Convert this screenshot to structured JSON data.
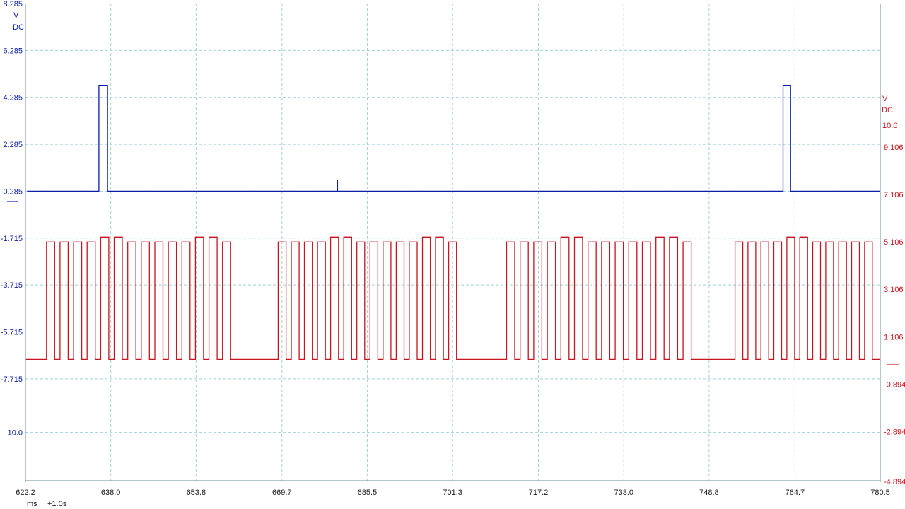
{
  "colors": {
    "channel_a": "#0b1fa8",
    "channel_b": "#c8141e",
    "grid": "#9fd2d8",
    "axis_text": "#1a1a1a",
    "background": "#ffffff"
  },
  "time_axis": {
    "unit_label": "ms",
    "offset_label": "+1.0s",
    "ticks": [
      "622.2",
      "638.0",
      "653.8",
      "669.7",
      "685.5",
      "701.3",
      "717.2",
      "733.0",
      "748.8",
      "764.7",
      "780.5"
    ]
  },
  "chart_data": {
    "type": "line",
    "grid": true,
    "x_range": [
      622.2,
      780.5
    ],
    "x_ticks": [
      622.2,
      638.0,
      653.8,
      669.7,
      685.5,
      701.3,
      717.2,
      733.0,
      748.8,
      764.7,
      780.5
    ],
    "y_left": {
      "unit": "V",
      "coupling": "DC",
      "range": [
        -12.0,
        8.285
      ],
      "tick_labels": [
        "8.285",
        "6.285",
        "4.285",
        "2.285",
        "0.285",
        "-1.715",
        "-3.715",
        "-5.715",
        "-7.715",
        "-10.0"
      ],
      "tick_values": [
        8.285,
        6.285,
        4.285,
        2.285,
        0.285,
        -1.715,
        -3.715,
        -5.715,
        -7.715,
        -10.0
      ]
    },
    "y_right": {
      "unit": "V",
      "coupling": "DC",
      "range": [
        -4.894,
        12.0
      ],
      "tick_labels": [
        "10.0",
        "9.106",
        "7.106",
        "5.106",
        "3.106",
        "1.106",
        "-0.894",
        "-2.894",
        "-4.894"
      ],
      "tick_values": [
        10.0,
        9.106,
        7.106,
        5.106,
        3.106,
        1.106,
        -0.894,
        -2.894,
        -4.894
      ]
    },
    "series": [
      {
        "axis": "left",
        "baseline": 0.285,
        "pulses": [
          {
            "start": 635.8,
            "end": 637.4,
            "value": 4.8
          },
          {
            "start": 762.5,
            "end": 763.9,
            "value": 4.8
          }
        ],
        "spikes": [
          {
            "x": 680.0,
            "value": 0.75
          }
        ]
      },
      {
        "axis": "right",
        "low": 0.15,
        "high": 5.1,
        "bursts": [
          {
            "start": 626.1,
            "end": 661.2,
            "pulses": 14
          },
          {
            "start": 669.0,
            "end": 703.0,
            "pulses": 14
          },
          {
            "start": 711.3,
            "end": 746.5,
            "pulses": 14
          },
          {
            "start": 753.6,
            "end": 780.0,
            "pulses": 11
          }
        ]
      }
    ]
  }
}
